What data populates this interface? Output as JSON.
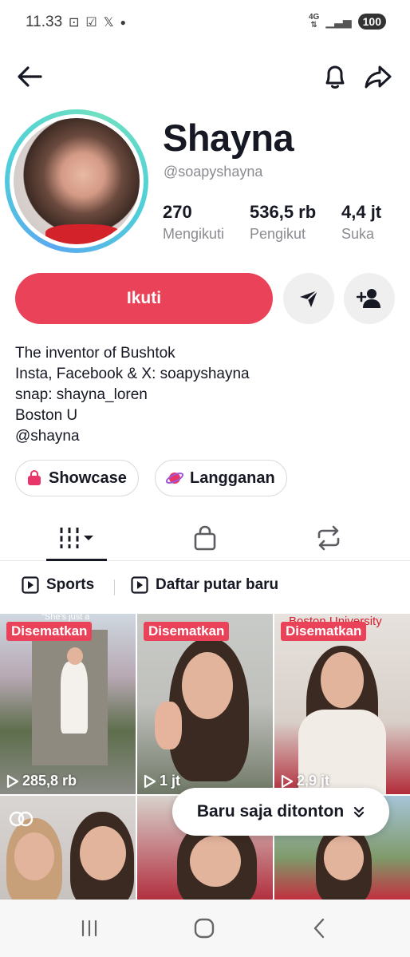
{
  "status_bar": {
    "time": "11.33",
    "network": "4G",
    "battery": "100"
  },
  "profile": {
    "name": "Shayna",
    "handle": "@soapyshayna",
    "stats": [
      {
        "value": "270",
        "label": "Mengikuti"
      },
      {
        "value": "536,5 rb",
        "label": "Pengikut"
      },
      {
        "value": "4,4 jt",
        "label": "Suka"
      }
    ],
    "follow_label": "Ikuti",
    "bio": [
      "The inventor of Bushtok",
      "Insta, Facebook & X: soapyshayna",
      "snap: shayna_loren",
      "Boston U",
      "@shayna"
    ],
    "pills": [
      {
        "label": "Showcase",
        "icon": "shopping-bag-icon"
      },
      {
        "label": "Langganan",
        "icon": "planet-icon"
      }
    ]
  },
  "tabs": [
    {
      "name": "videos-grid",
      "icon": "grid-icon",
      "active": true
    },
    {
      "name": "shop",
      "icon": "bag-icon",
      "active": false
    },
    {
      "name": "reposts",
      "icon": "repost-icon",
      "active": false
    }
  ],
  "playlists": [
    {
      "label": "Sports",
      "icon": "play-square-icon"
    },
    {
      "label": "Daftar putar baru",
      "icon": "play-square-icon"
    }
  ],
  "videos": [
    {
      "pinned_label": "Disematkan",
      "views": "285,8 rb",
      "caption": "\"She's just a"
    },
    {
      "pinned_label": "Disematkan",
      "views": "1 jt",
      "caption": ""
    },
    {
      "pinned_label": "Disematkan",
      "views": "2,9 jt",
      "caption": "Boston University"
    },
    {
      "pinned_label": "",
      "views": "",
      "caption": ""
    },
    {
      "pinned_label": "",
      "views": "",
      "caption": ""
    },
    {
      "pinned_label": "",
      "views": "",
      "caption": ""
    }
  ],
  "recently_watched": {
    "label": "Baru saja ditonton"
  },
  "colors": {
    "accent": "#ea4359",
    "text": "#161823",
    "muted": "#8a8b91",
    "ring": "#4fd0d8"
  }
}
